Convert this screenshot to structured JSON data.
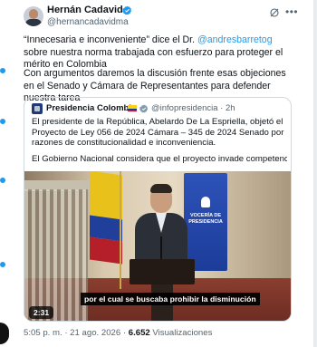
{
  "author": {
    "name": "Hernán Cadavid",
    "handle": "@hernancadavidma"
  },
  "tweet": {
    "p1_before": "“Innecesaria e inconveniente” dice el Dr. ",
    "p1_mention": "@andresbarretog",
    "p1_after": " sobre nuestra norma trabajada con esfuerzo para proteger el mérito en Colombia",
    "p2": "Con argumentos daremos la discusión frente esas objeciones en el Senado y Cámara de Representantes para defender nuestra tarea"
  },
  "quote": {
    "name": "Presidencia Colombia",
    "handle_time": "@infopresidencia · 2h",
    "text1": "El presidente de la República, Abelardo De La Espriella, objetó el Proyecto de Ley 056 de 2024 Cámara – 345 de 2024 Senado por razones de constitucionalidad e inconveniencia.",
    "text2": "El Gobierno Nacional considera que el proyecto invade competencias propia…",
    "video": {
      "panel_text": "VOCERÍA DE PRESIDENCIA",
      "caption": "por el cual se buscaba prohibir la disminución",
      "duration": "2:31"
    }
  },
  "meta": {
    "time_date": "5:05 p. m. · 21 ago. 2026 · ",
    "views_count": "6.652",
    "views_label": " Visualizaciones"
  },
  "colors": {
    "accent": "#1d9bf0",
    "text": "#0f1419",
    "muted": "#536471",
    "border": "#cfd9de"
  },
  "icons": [
    "verified-badge-icon",
    "grok-icon",
    "more-options-icon",
    "gov-badge-icon",
    "colombia-flag-icon"
  ]
}
